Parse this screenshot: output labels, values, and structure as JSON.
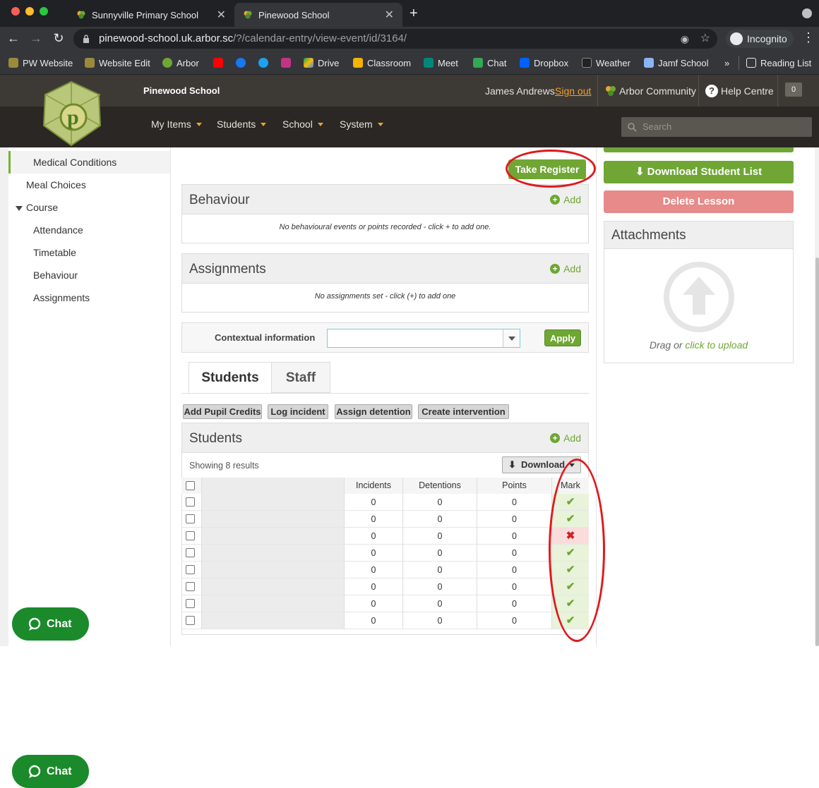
{
  "browser": {
    "tabs": [
      {
        "title": "Sunnyville Primary School",
        "close": "✕"
      },
      {
        "title": "Pinewood School",
        "close": "✕"
      }
    ],
    "url_host": "pinewood-school.uk.arbor.sc",
    "url_path": "/?/calendar-entry/view-event/id/3164/",
    "incognito_label": "Incognito",
    "bookmarks": [
      "PW Website",
      "Website Edit",
      "Arbor",
      "Drive",
      "Classroom",
      "Meet",
      "Chat",
      "Dropbox",
      "Weather",
      "Jamf School"
    ],
    "more": "»",
    "reading_list": "Reading List"
  },
  "header": {
    "school_name": "Pinewood School",
    "user_name": "James Andrews",
    "sign_out": "Sign out",
    "community": "Arbor Community",
    "help": "Help Centre",
    "notification_count": "0",
    "menu": [
      "My Items",
      "Students",
      "School",
      "System"
    ],
    "search_placeholder": "Search"
  },
  "sidebar": {
    "items": [
      {
        "label": "Medical Conditions",
        "selected": true
      },
      {
        "label": "Meal Choices"
      },
      {
        "label": "Course",
        "expanded": true
      },
      {
        "label": "Attendance"
      },
      {
        "label": "Timetable"
      },
      {
        "label": "Behaviour"
      },
      {
        "label": "Assignments"
      }
    ]
  },
  "main": {
    "take_register": "Take Register",
    "behaviour": {
      "title": "Behaviour",
      "add": "Add",
      "empty": "No behavioural events or points recorded - click + to add one."
    },
    "assignments": {
      "title": "Assignments",
      "add": "Add",
      "empty": "No assignments set - click (+) to add one"
    },
    "contextual": {
      "label": "Contextual information",
      "value": "",
      "apply": "Apply"
    },
    "tabs": [
      "Students",
      "Staff"
    ],
    "actions": [
      "Add Pupil Credits",
      "Log incident",
      "Assign detention",
      "Create intervention"
    ],
    "students": {
      "title": "Students",
      "add": "Add",
      "showing": "Showing 8 results",
      "download": "Download",
      "columns": [
        "Incidents",
        "Detentions",
        "Points",
        "Mark"
      ],
      "rows": [
        {
          "incidents": "0",
          "detentions": "0",
          "points": "0",
          "mark": "present"
        },
        {
          "incidents": "0",
          "detentions": "0",
          "points": "0",
          "mark": "present"
        },
        {
          "incidents": "0",
          "detentions": "0",
          "points": "0",
          "mark": "absent"
        },
        {
          "incidents": "0",
          "detentions": "0",
          "points": "0",
          "mark": "present"
        },
        {
          "incidents": "0",
          "detentions": "0",
          "points": "0",
          "mark": "present"
        },
        {
          "incidents": "0",
          "detentions": "0",
          "points": "0",
          "mark": "present"
        },
        {
          "incidents": "0",
          "detentions": "0",
          "points": "0",
          "mark": "present"
        },
        {
          "incidents": "0",
          "detentions": "0",
          "points": "0",
          "mark": "present"
        }
      ]
    }
  },
  "right": {
    "download_student_list": "Download Student List",
    "delete_lesson": "Delete Lesson",
    "attachments": {
      "title": "Attachments",
      "drag": "Drag or ",
      "click": "click to upload"
    }
  },
  "chat_widget": "Chat",
  "colors": {
    "accent_green": "#6fa634",
    "present_bg": "#e8f3da",
    "absent_bg": "#fbdcdc",
    "annotation_red": "#e0191d"
  }
}
